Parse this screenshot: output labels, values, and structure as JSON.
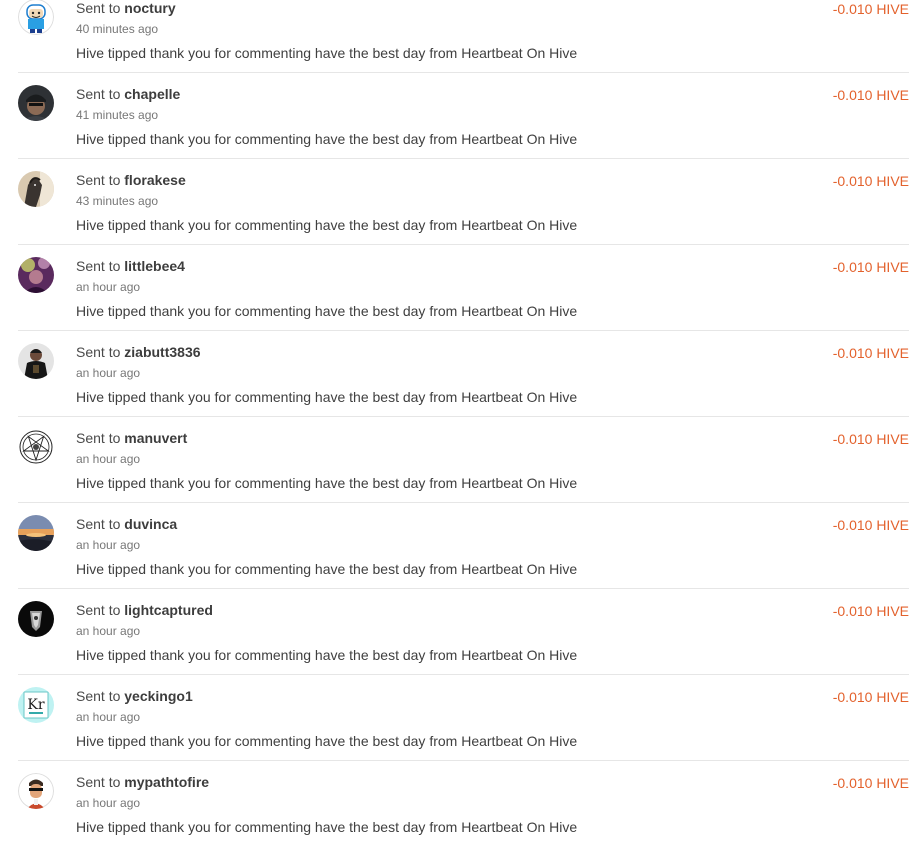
{
  "transfers": [
    {
      "prefix": "Sent to",
      "user": "noctury",
      "time": "40 minutes ago",
      "memo": "Hive tipped thank you for commenting have the best day from Heartbeat On Hive",
      "amount": "-0.010 HIVE",
      "avatar": "cartoon-character-avatar"
    },
    {
      "prefix": "Sent to",
      "user": "chapelle",
      "time": "41 minutes ago",
      "memo": "Hive tipped thank you for commenting have the best day from Heartbeat On Hive",
      "amount": "-0.010 HIVE",
      "avatar": "man-in-cap-avatar"
    },
    {
      "prefix": "Sent to",
      "user": "florakese",
      "time": "43 minutes ago",
      "memo": "Hive tipped thank you for commenting have the best day from Heartbeat On Hive",
      "amount": "-0.010 HIVE",
      "avatar": "horse-avatar"
    },
    {
      "prefix": "Sent to",
      "user": "littlebee4",
      "time": "an hour ago",
      "memo": "Hive tipped thank you for commenting have the best day from Heartbeat On Hive",
      "amount": "-0.010 HIVE",
      "avatar": "purple-portrait-avatar"
    },
    {
      "prefix": "Sent to",
      "user": "ziabutt3836",
      "time": "an hour ago",
      "memo": "Hive tipped thank you for commenting have the best day from Heartbeat On Hive",
      "amount": "-0.010 HIVE",
      "avatar": "man-in-black-avatar"
    },
    {
      "prefix": "Sent to",
      "user": "manuvert",
      "time": "an hour ago",
      "memo": "Hive tipped thank you for commenting have the best day from Heartbeat On Hive",
      "amount": "-0.010 HIVE",
      "avatar": "pentagram-avatar"
    },
    {
      "prefix": "Sent to",
      "user": "duvinca",
      "time": "an hour ago",
      "memo": "Hive tipped thank you for commenting have the best day from Heartbeat On Hive",
      "amount": "-0.010 HIVE",
      "avatar": "sunset-avatar"
    },
    {
      "prefix": "Sent to",
      "user": "lightcaptured",
      "time": "an hour ago",
      "memo": "Hive tipped thank you for commenting have the best day from Heartbeat On Hive",
      "amount": "-0.010 HIVE",
      "avatar": "dark-logo-avatar"
    },
    {
      "prefix": "Sent to",
      "user": "yeckingo1",
      "time": "an hour ago",
      "memo": "Hive tipped thank you for commenting have the best day from Heartbeat On Hive",
      "amount": "-0.010 HIVE",
      "avatar": "krypton-element-avatar",
      "avatar_text": "Kr"
    },
    {
      "prefix": "Sent to",
      "user": "mypathtofire",
      "time": "an hour ago",
      "memo": "Hive tipped thank you for commenting have the best day from Heartbeat On Hive",
      "amount": "-0.010 HIVE",
      "avatar": "man-with-sunglasses-avatar"
    }
  ],
  "colors": {
    "amount": "#e3622d",
    "divider": "#e6e6e6",
    "text": "#3f3f3f",
    "muted": "#777777"
  }
}
